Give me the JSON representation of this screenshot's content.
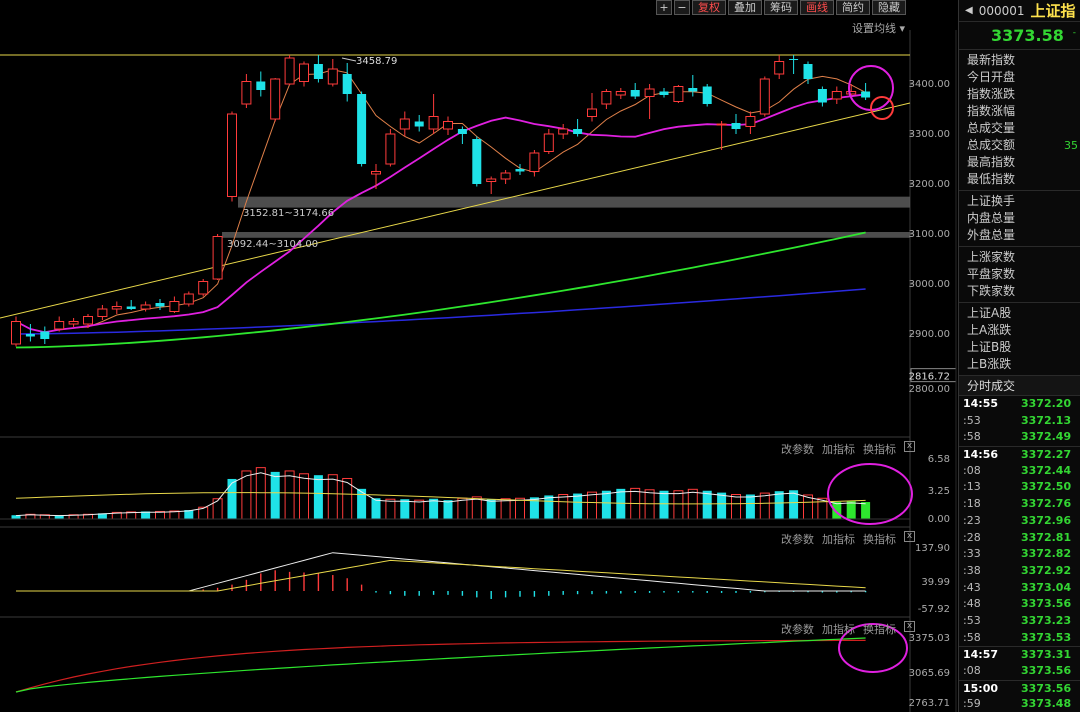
{
  "toolbar": {
    "buttons": [
      "+",
      "−",
      "复权",
      "叠加",
      "筹码",
      "画线",
      "简约",
      "隐藏"
    ],
    "setting_ma": "设置均线"
  },
  "axis": {
    "main_ticks": [
      "3400.00",
      "3300.00",
      "3200.00",
      "3100.00",
      "3000.00",
      "2900.00",
      "2816.72",
      "2800.00"
    ],
    "panel1_ticks": [
      "6.58",
      "3.25",
      "0.00"
    ],
    "panel2_ticks": [
      "137.90",
      "39.99",
      "-57.92"
    ],
    "panel3_ticks": [
      "3375.03",
      "3065.69",
      "2763.71"
    ]
  },
  "annotations": {
    "high_label": "3458.79",
    "gap1_label": "3152.81~3174.66",
    "gap2_label": "3092.44~3104.00"
  },
  "panel_tools": {
    "change_params": "改参数",
    "add_indicator": "加指标",
    "switch_indicator": "换指标",
    "close": "x"
  },
  "sidebar": {
    "code": "000001",
    "name": "上证指",
    "price": "3373.58",
    "small_change": "-",
    "groups": [
      [
        {
          "label": "最新指数"
        },
        {
          "label": "今日开盘"
        },
        {
          "label": "指数涨跌"
        },
        {
          "label": "指数涨幅"
        },
        {
          "label": "总成交量"
        },
        {
          "label": "总成交额",
          "value": "35"
        },
        {
          "label": "最高指数"
        },
        {
          "label": "最低指数"
        }
      ],
      [
        {
          "label": "上证换手"
        },
        {
          "label": "内盘总量"
        },
        {
          "label": "外盘总量"
        }
      ],
      [
        {
          "label": "上涨家数"
        },
        {
          "label": "平盘家数"
        },
        {
          "label": "下跌家数"
        }
      ],
      [
        {
          "label": "上证A股"
        },
        {
          "label": "上A涨跌"
        },
        {
          "label": "上证B股"
        },
        {
          "label": "上B涨跌"
        }
      ]
    ],
    "fenshi_title": "分时成交",
    "ticks": [
      {
        "time": "14:55",
        "price": "3372.20",
        "major": true
      },
      {
        "time": ":53",
        "price": "3372.13"
      },
      {
        "time": ":58",
        "price": "3372.49"
      },
      {
        "time": "14:56",
        "price": "3372.27",
        "major": true
      },
      {
        "time": ":08",
        "price": "3372.44"
      },
      {
        "time": ":13",
        "price": "3372.50"
      },
      {
        "time": ":18",
        "price": "3372.76"
      },
      {
        "time": ":23",
        "price": "3372.96"
      },
      {
        "time": ":28",
        "price": "3372.81"
      },
      {
        "time": ":33",
        "price": "3372.82"
      },
      {
        "time": ":38",
        "price": "3372.92"
      },
      {
        "time": ":43",
        "price": "3373.04"
      },
      {
        "time": ":48",
        "price": "3373.56"
      },
      {
        "time": ":53",
        "price": "3373.23"
      },
      {
        "time": ":58",
        "price": "3373.53"
      },
      {
        "time": "14:57",
        "price": "3373.31",
        "major": true
      },
      {
        "time": ":08",
        "price": "3373.56"
      },
      {
        "time": "15:00",
        "price": "3373.56",
        "major": true
      },
      {
        "time": ":59",
        "price": "3373.48"
      },
      {
        "time": ":59",
        "price": "3373.48"
      }
    ]
  },
  "candles": [
    {
      "o": 2880,
      "c": 2925,
      "h": 2935,
      "l": 2875
    },
    {
      "o": 2900,
      "c": 2895,
      "h": 2920,
      "l": 2885
    },
    {
      "o": 2905,
      "c": 2890,
      "h": 2915,
      "l": 2880
    },
    {
      "o": 2910,
      "c": 2925,
      "h": 2935,
      "l": 2905
    },
    {
      "o": 2920,
      "c": 2925,
      "h": 2932,
      "l": 2914
    },
    {
      "o": 2920,
      "c": 2935,
      "h": 2940,
      "l": 2912
    },
    {
      "o": 2935,
      "c": 2950,
      "h": 2958,
      "l": 2928
    },
    {
      "o": 2950,
      "c": 2955,
      "h": 2965,
      "l": 2940
    },
    {
      "o": 2955,
      "c": 2950,
      "h": 2968,
      "l": 2948
    },
    {
      "o": 2950,
      "c": 2958,
      "h": 2965,
      "l": 2945
    },
    {
      "o": 2962,
      "c": 2955,
      "h": 2970,
      "l": 2948
    },
    {
      "o": 2945,
      "c": 2965,
      "h": 2975,
      "l": 2942
    },
    {
      "o": 2960,
      "c": 2980,
      "h": 2985,
      "l": 2955
    },
    {
      "o": 2980,
      "c": 3005,
      "h": 3010,
      "l": 2975
    },
    {
      "o": 3010,
      "c": 3095,
      "h": 3100,
      "l": 3008
    },
    {
      "o": 3175,
      "c": 3340,
      "h": 3345,
      "l": 3165
    },
    {
      "o": 3360,
      "c": 3405,
      "h": 3420,
      "l": 3352
    },
    {
      "o": 3405,
      "c": 3388,
      "h": 3425,
      "l": 3375
    },
    {
      "o": 3330,
      "c": 3410,
      "h": 3412,
      "l": 3325
    },
    {
      "o": 3400,
      "c": 3452,
      "h": 3458,
      "l": 3398
    },
    {
      "o": 3405,
      "c": 3440,
      "h": 3445,
      "l": 3395
    },
    {
      "o": 3440,
      "c": 3410,
      "h": 3458,
      "l": 3403
    },
    {
      "o": 3400,
      "c": 3430,
      "h": 3450,
      "l": 3395
    },
    {
      "o": 3420,
      "c": 3380,
      "h": 3442,
      "l": 3365
    },
    {
      "o": 3380,
      "c": 3240,
      "h": 3385,
      "l": 3235
    },
    {
      "o": 3220,
      "c": 3225,
      "h": 3240,
      "l": 3190
    },
    {
      "o": 3240,
      "c": 3300,
      "h": 3310,
      "l": 3235
    },
    {
      "o": 3310,
      "c": 3330,
      "h": 3345,
      "l": 3295
    },
    {
      "o": 3325,
      "c": 3315,
      "h": 3338,
      "l": 3305
    },
    {
      "o": 3310,
      "c": 3335,
      "h": 3380,
      "l": 3300
    },
    {
      "o": 3310,
      "c": 3325,
      "h": 3335,
      "l": 3298
    },
    {
      "o": 3310,
      "c": 3300,
      "h": 3315,
      "l": 3280
    },
    {
      "o": 3290,
      "c": 3200,
      "h": 3295,
      "l": 3195
    },
    {
      "o": 3205,
      "c": 3210,
      "h": 3215,
      "l": 3180
    },
    {
      "o": 3210,
      "c": 3222,
      "h": 3228,
      "l": 3200
    },
    {
      "o": 3230,
      "c": 3225,
      "h": 3240,
      "l": 3218
    },
    {
      "o": 3225,
      "c": 3262,
      "h": 3268,
      "l": 3215
    },
    {
      "o": 3265,
      "c": 3300,
      "h": 3310,
      "l": 3260
    },
    {
      "o": 3300,
      "c": 3310,
      "h": 3320,
      "l": 3290
    },
    {
      "o": 3310,
      "c": 3300,
      "h": 3330,
      "l": 3295
    },
    {
      "o": 3335,
      "c": 3350,
      "h": 3382,
      "l": 3325
    },
    {
      "o": 3360,
      "c": 3385,
      "h": 3390,
      "l": 3350
    },
    {
      "o": 3378,
      "c": 3385,
      "h": 3392,
      "l": 3370
    },
    {
      "o": 3388,
      "c": 3375,
      "h": 3402,
      "l": 3370
    },
    {
      "o": 3375,
      "c": 3390,
      "h": 3400,
      "l": 3330
    },
    {
      "o": 3385,
      "c": 3378,
      "h": 3392,
      "l": 3373
    },
    {
      "o": 3365,
      "c": 3395,
      "h": 3398,
      "l": 3362
    },
    {
      "o": 3392,
      "c": 3385,
      "h": 3418,
      "l": 3375
    },
    {
      "o": 3395,
      "c": 3360,
      "h": 3400,
      "l": 3355
    },
    {
      "o": 3320,
      "c": 3320,
      "h": 3326,
      "l": 3268
    },
    {
      "o": 3322,
      "c": 3310,
      "h": 3340,
      "l": 3300
    },
    {
      "o": 3315,
      "c": 3335,
      "h": 3345,
      "l": 3300
    },
    {
      "o": 3340,
      "c": 3410,
      "h": 3415,
      "l": 3335
    },
    {
      "o": 3420,
      "c": 3445,
      "h": 3458,
      "l": 3410
    },
    {
      "o": 3450,
      "c": 3448,
      "h": 3458,
      "l": 3420
    },
    {
      "o": 3440,
      "c": 3410,
      "h": 3445,
      "l": 3400
    },
    {
      "o": 3390,
      "c": 3363,
      "h": 3395,
      "l": 3355
    },
    {
      "o": 3370,
      "c": 3385,
      "h": 3395,
      "l": 3360
    },
    {
      "o": 3380,
      "c": 3385,
      "h": 3400,
      "l": 3370
    },
    {
      "o": 3385,
      "c": 3373,
      "h": 3402,
      "l": 3368
    }
  ],
  "macd_hist": [
    0.4,
    0.5,
    0.45,
    0.4,
    0.45,
    0.5,
    0.6,
    0.7,
    0.75,
    0.8,
    0.8,
    0.85,
    0.95,
    1.25,
    2.15,
    4.25,
    5.1,
    5.45,
    5.0,
    5.1,
    4.8,
    4.65,
    4.7,
    4.3,
    3.2,
    2.2,
    2.1,
    2.1,
    2.0,
    2.15,
    2.0,
    2.2,
    2.35,
    2.1,
    2.15,
    2.2,
    2.3,
    2.5,
    2.6,
    2.7,
    2.85,
    3.0,
    3.2,
    3.25,
    3.1,
    3.0,
    3.0,
    3.15,
    3.0,
    2.8,
    2.6,
    2.6,
    2.75,
    2.95,
    3.05,
    2.55,
    2.2,
    1.8,
    1.9,
    1.8
  ],
  "indicator2_bars": [
    0,
    0,
    0,
    0,
    0,
    0,
    0,
    0,
    0,
    0,
    0,
    0,
    0,
    5,
    10,
    20,
    35,
    55,
    65,
    60,
    58,
    55,
    50,
    40,
    20,
    -5,
    -10,
    -15,
    -15,
    -12,
    -12,
    -15,
    -20,
    -25,
    -20,
    -18,
    -18,
    -15,
    -12,
    -10,
    -10,
    -8,
    -8,
    -6,
    -6,
    -5,
    -5,
    -5,
    -6,
    -6,
    -6,
    -5,
    -4,
    -3,
    -3,
    -4,
    -5,
    -5,
    -4,
    -4
  ]
}
